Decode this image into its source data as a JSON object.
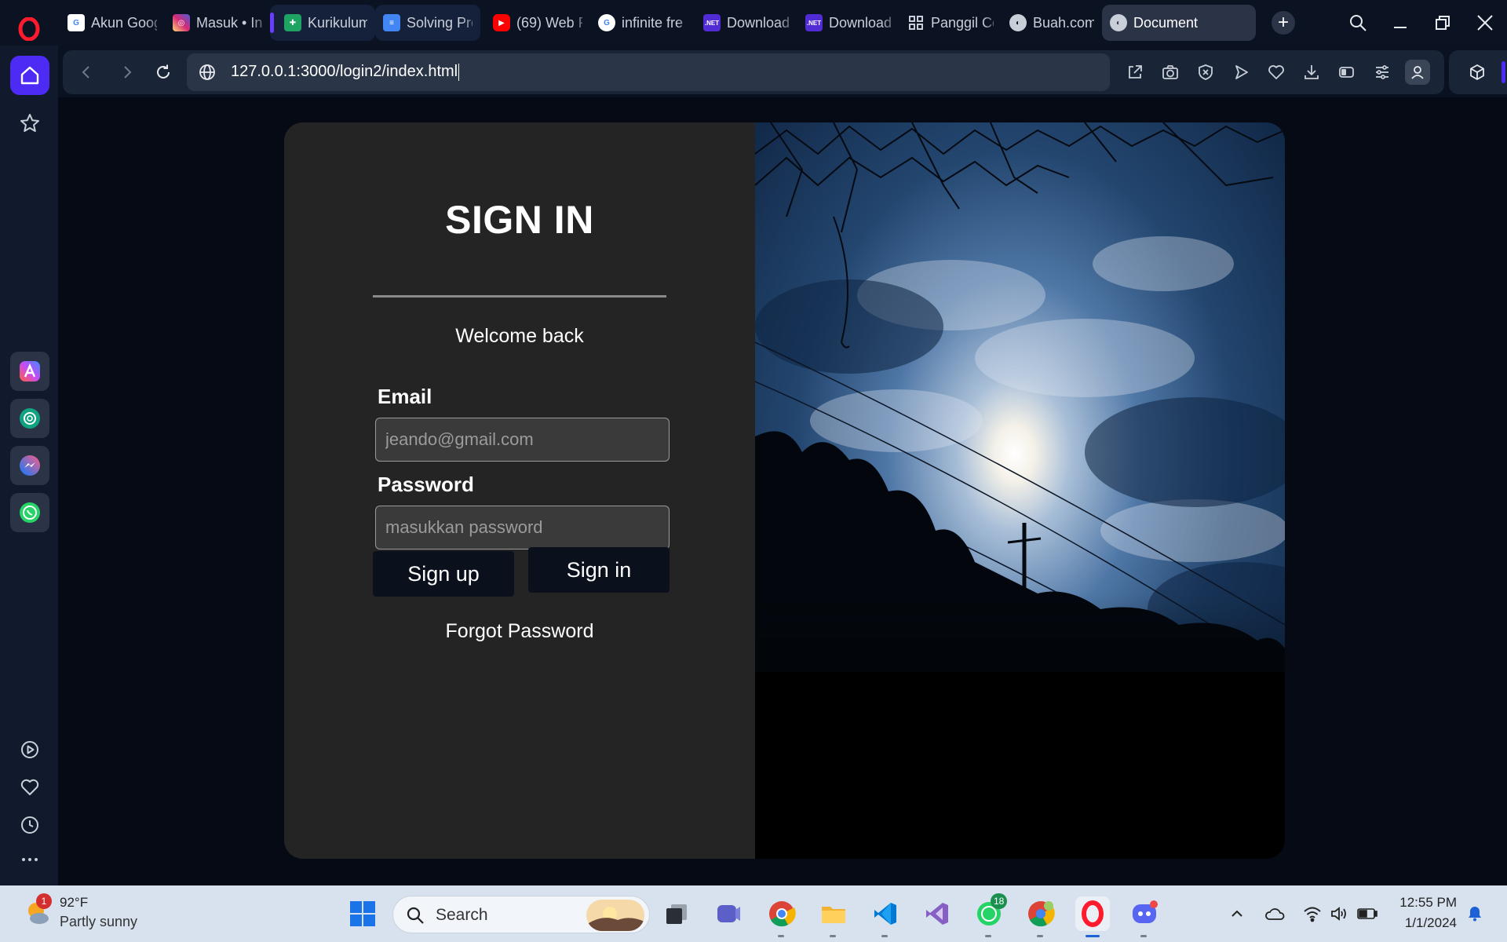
{
  "browser": {
    "tabs": [
      {
        "label": "Akun Goog",
        "icon": "google-icon",
        "color": "#ffffff"
      },
      {
        "label": "Masuk • In",
        "icon": "instagram-icon",
        "color": "#d62976"
      },
      {
        "label": "Kurikulum",
        "icon": "sheets-icon",
        "color": "#1ea362"
      },
      {
        "label": "Solving Pro",
        "icon": "docs-icon",
        "color": "#4285f4"
      },
      {
        "label": "(69) Web P",
        "icon": "youtube-icon",
        "color": "#ff0000"
      },
      {
        "label": "infinite fre",
        "icon": "google-icon",
        "color": "#ffffff"
      },
      {
        "label": "Download",
        "icon": "dotnet-icon",
        "color": "#512bd4"
      },
      {
        "label": "Download",
        "icon": "dotnet-icon",
        "color": "#512bd4"
      },
      {
        "label": "Panggil Ce",
        "icon": "grid-icon",
        "color": "#c9cfd9"
      },
      {
        "label": "Buah.com",
        "icon": "globe-icon",
        "color": "#c9cfd9"
      },
      {
        "label": "Document",
        "icon": "globe-icon",
        "color": "#c9cfd9"
      }
    ],
    "url": "127.0.0.1:3000/login2/index.html",
    "accent": "#4d2bf5"
  },
  "login": {
    "title": "SIGN IN",
    "welcome": "Welcome back",
    "email_label": "Email",
    "email_placeholder": "jeando@gmail.com",
    "password_label": "Password",
    "password_placeholder": "masukkan password",
    "signup_label": "Sign up",
    "signin_label": "Sign in",
    "forgot_label": "Forgot Password"
  },
  "taskbar": {
    "weather_temp": "92°F",
    "weather_desc": "Partly sunny",
    "weather_badge": "1",
    "search_label": "Search",
    "whatsapp_badge": "18",
    "time": "12:55 PM",
    "date": "1/1/2024"
  }
}
